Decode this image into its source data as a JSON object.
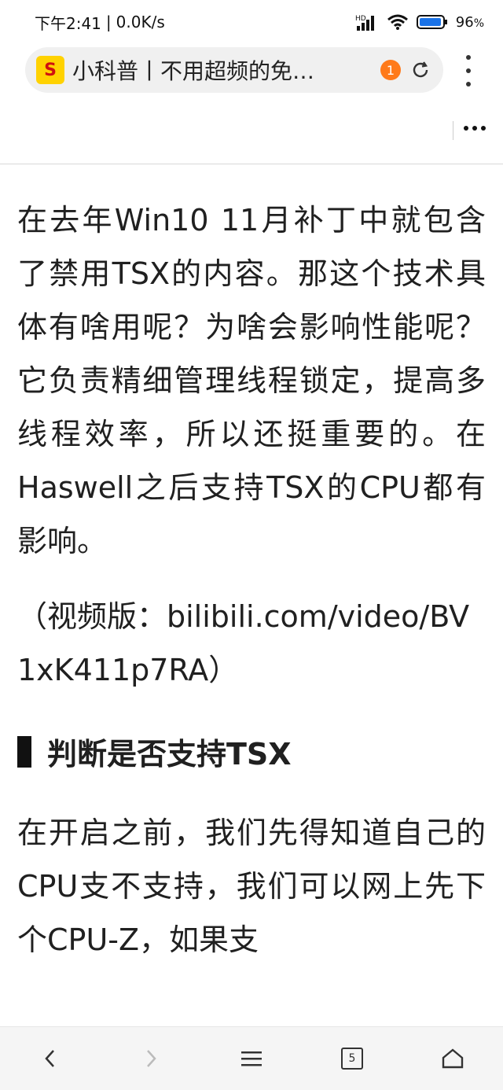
{
  "status": {
    "time": "下午2:41",
    "speed": "0.0K/s",
    "hd_label": "HD",
    "battery": "96",
    "battery_suffix": "%"
  },
  "urlbar": {
    "site_icon_glyph": "S",
    "title": "小科普丨不用超频的免…",
    "badge": "1"
  },
  "article": {
    "paragraphs": [
      "在去年Win10 11月补丁中就包含了禁用TSX的内容。那这个技术具体有啥用呢？为啥会影响性能呢？它负责精细管理线程锁定，提高多线程效率，所以还挺重要的。在Haswell之后支持TSX的CPU都有影响。"
    ],
    "video_line": "（视频版：bilibili.com/video/BV1xK411p7RA）",
    "heading": "判断是否支持TSX",
    "last_paragraph": "在开启之前，我们先得知道自己的CPU支不支持，我们可以网上先下个CPU-Z，如果支"
  },
  "bottom_nav": {
    "tabs_count": "5"
  }
}
